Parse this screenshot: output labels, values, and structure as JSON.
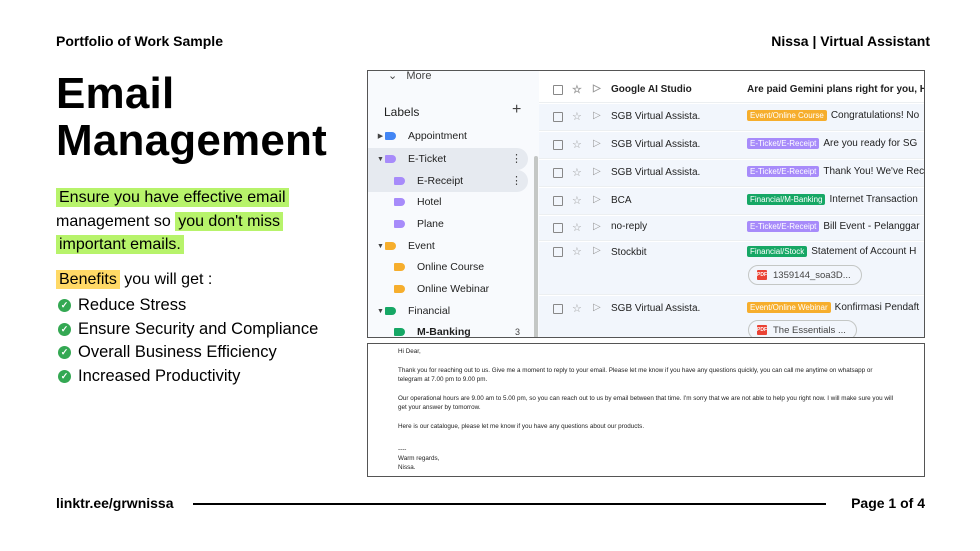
{
  "header": {
    "left": "Portfolio of Work Sample",
    "right": "Nissa | Virtual Assistant"
  },
  "title": {
    "line1": "Email",
    "line2": "Management"
  },
  "intro": {
    "part1": "Ensure you have effective email",
    "part2": "management so",
    "part3": "you don't miss",
    "part4": "important emails."
  },
  "benefits": {
    "highlight": "Benefits",
    "rest": " you will get :",
    "items": [
      "Reduce Stress",
      "Ensure Security and Compliance",
      "Overall Business Efficiency",
      "Increased Productivity"
    ]
  },
  "footer": {
    "link": "linktr.ee/grwnissa",
    "page": "Page 1 of 4"
  },
  "gmail": {
    "more": "More",
    "labels_title": "Labels",
    "labels": [
      {
        "name": "Appointment",
        "color": "#4285f4"
      },
      {
        "name": "E-Ticket",
        "color": "#a78bfa"
      },
      {
        "name": "E-Receipt",
        "color": "#a78bfa"
      },
      {
        "name": "Hotel",
        "color": "#a78bfa"
      },
      {
        "name": "Plane",
        "color": "#a78bfa"
      },
      {
        "name": "Event",
        "color": "#f6ae2d"
      },
      {
        "name": "Online Course",
        "color": "#f6ae2d"
      },
      {
        "name": "Online Webinar",
        "color": "#f6ae2d"
      },
      {
        "name": "Financial",
        "color": "#16a765"
      },
      {
        "name": "M-Banking",
        "color": "#16a765",
        "count": "3"
      }
    ],
    "rows": [
      {
        "sender": "Google AI Studio",
        "chip": "",
        "chip_color": "",
        "subject": "Are paid Gemini plans right for you, H"
      },
      {
        "sender": "SGB Virtual Assista.",
        "chip": "Event/Online Course",
        "chip_color": "#f6ae2d",
        "subject": "Congratulations! No"
      },
      {
        "sender": "SGB Virtual Assista.",
        "chip": "E-Ticket/E-Receipt",
        "chip_color": "#a78bfa",
        "subject": "Are you ready for SG"
      },
      {
        "sender": "SGB Virtual Assista.",
        "chip": "E-Ticket/E-Receipt",
        "chip_color": "#a78bfa",
        "subject": "Thank You! We've Rec"
      },
      {
        "sender": "BCA",
        "chip": "Financial/M-Banking",
        "chip_color": "#16a765",
        "subject": "Internet Transaction"
      },
      {
        "sender": "no-reply",
        "chip": "E-Ticket/E-Receipt",
        "chip_color": "#a78bfa",
        "subject": "Bill Event - Pelanggar"
      },
      {
        "sender": "Stockbit",
        "chip": "Financial/Stock",
        "chip_color": "#16a765",
        "subject": "Statement of Account H",
        "attachment": "1359144_soa3D..."
      },
      {
        "sender": "SGB Virtual Assista.",
        "chip": "Event/Online Webinar",
        "chip_color": "#f6ae2d",
        "subject": "Konfirmasi Pendaft",
        "attachment": "The Essentials ..."
      }
    ]
  },
  "email": {
    "greeting": "Hi Dear,",
    "p1": "Thank you for reaching out to us. Give me a moment to reply to your email. Please let me know if you have any questions quickly, you can call me anytime on whatsapp or telegram at 7.00 pm to 9.00 pm.",
    "p2": "Our operational hours are 9.00 am to 5.00 pm, so you can reach out to us by email between that time. I'm sorry that we are not able to help you right now. I will make sure you will get your answer by tomorrow.",
    "p3": "Here is our catalogue, please let me know if you have any questions about our products.",
    "sep": "----",
    "closing": "Warm regards,",
    "signature": "Nissa."
  }
}
